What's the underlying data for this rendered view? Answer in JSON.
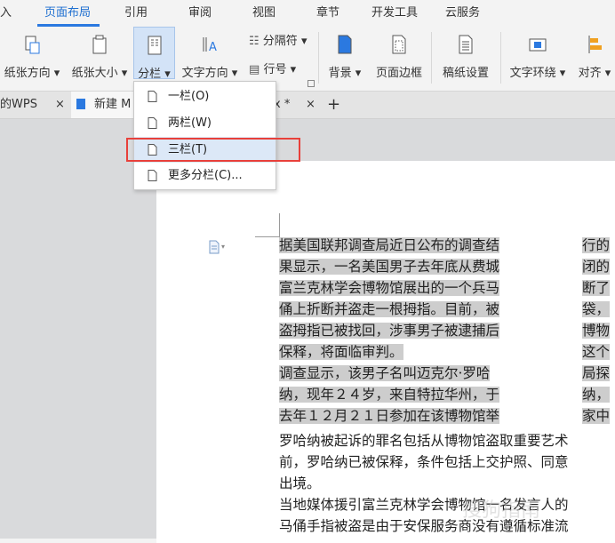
{
  "menu": {
    "items": [
      "入",
      "页面布局",
      "引用",
      "审阅",
      "视图",
      "章节",
      "开发工具",
      "云服务"
    ],
    "active_index": 1
  },
  "ribbon": {
    "paper_orientation": "纸张方向",
    "paper_size": "纸张大小",
    "columns": "分栏",
    "text_direction": "文字方向",
    "separator": "分隔符",
    "line_number": "行号",
    "background": "背景",
    "page_border": "页面边框",
    "manuscript_settings": "稿纸设置",
    "text_wrap": "文字环绕",
    "align": "对齐"
  },
  "tabs": {
    "tab1": "的WPS",
    "tab2": "新建 M",
    "tab3_suffix": "x *",
    "close": "×",
    "add": "+"
  },
  "dropdown": {
    "items": [
      "一栏(O)",
      "两栏(W)",
      "三栏(T)",
      "更多分栏(C)..."
    ],
    "hover_index": 2
  },
  "document": {
    "col1_lines": [
      "据美国联邦调查局近日公布的调查结",
      "果显示，一名美国男子去年底从费城",
      "富兰克林学会博物馆展出的一个兵马",
      "俑上折断并盗走一根拇指。目前，被",
      "盗拇指已被找回，涉事男子被逮捕后",
      "保释，将面临审判。",
      "调查显示，该男子名叫迈克尔·罗哈",
      "纳，现年２４岁，来自特拉华州，于",
      "去年１２月２１日参加在该博物馆举"
    ],
    "col2_lines": [
      "行的",
      "闭的",
      "断了",
      "袋，",
      "博物",
      "这个",
      "局探",
      "纳，",
      "家中"
    ],
    "full_lines": [
      "罗哈纳被起诉的罪名包括从博物馆盗取重要艺术",
      "前，罗哈纳已被保释，条件包括上交护照、同意",
      "出境。",
      "当地媒体援引富兰克林学会博物馆一名发言人的",
      "马俑手指被盗是由于安保服务商没有遵循标准流"
    ]
  },
  "watermark": "搜狗指南"
}
